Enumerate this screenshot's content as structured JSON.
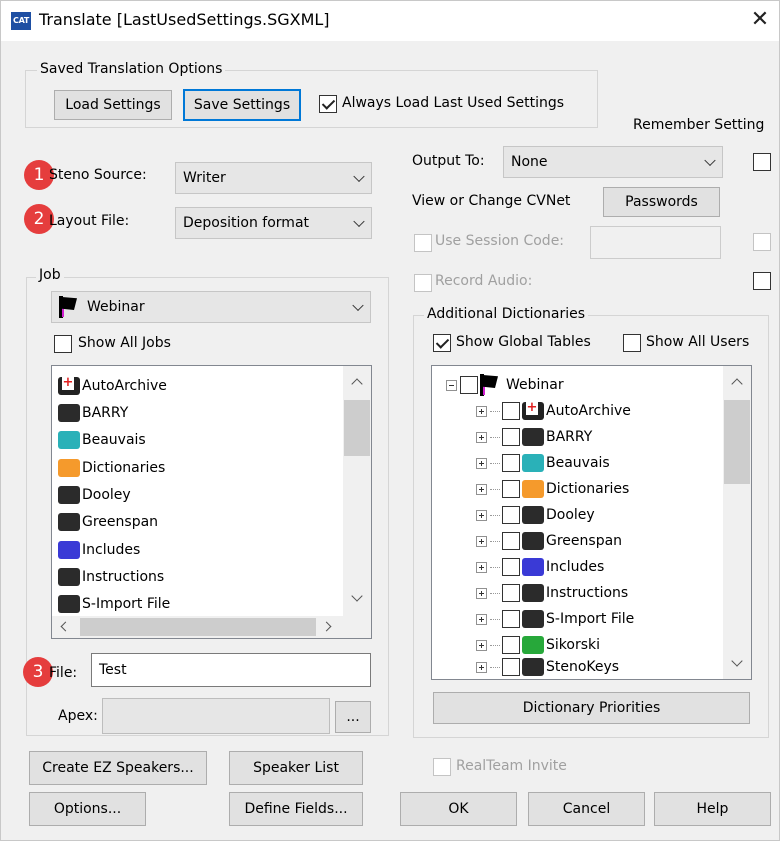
{
  "window": {
    "app_icon_text": "CAT",
    "title": "Translate [LastUsedSettings.SGXML]",
    "close_glyph": "✕"
  },
  "saved_options": {
    "group_label": "Saved Translation Options",
    "load_label": "Load Settings",
    "save_label": "Save Settings",
    "always_load_label": "Always Load Last Used Settings",
    "always_load_checked": true
  },
  "remember_setting_label": "Remember Setting",
  "badges": [
    "1",
    "2",
    "3"
  ],
  "steno_source": {
    "label": "Steno Source:",
    "value": "Writer"
  },
  "layout_file": {
    "label": "Layout File:",
    "value": "Deposition format"
  },
  "output_to": {
    "label": "Output To:",
    "value": "None"
  },
  "cvnet": {
    "label": "View or Change CVNet",
    "button": "Passwords"
  },
  "session_code": {
    "label": "Use Session Code:",
    "value": ""
  },
  "record_audio": {
    "label": "Record Audio:"
  },
  "job": {
    "group_label": "Job",
    "selected": "Webinar",
    "show_all_label": "Show All Jobs",
    "items": [
      {
        "label": "AutoArchive",
        "icon": "red-case-icon"
      },
      {
        "label": "BARRY",
        "icon": "black-case-icon"
      },
      {
        "label": "Beauvais",
        "icon": "teal-case-icon"
      },
      {
        "label": "Dictionaries",
        "icon": "orange-case-icon"
      },
      {
        "label": "Dooley",
        "icon": "black-case-icon"
      },
      {
        "label": "Greenspan",
        "icon": "black-case-icon"
      },
      {
        "label": "Includes",
        "icon": "blue-case-icon"
      },
      {
        "label": "Instructions",
        "icon": "black-case-icon"
      },
      {
        "label": "S-Import File",
        "icon": "black-case-icon"
      }
    ]
  },
  "file": {
    "label": "File:",
    "value": "Test"
  },
  "apex": {
    "label": "Apex:",
    "value": "",
    "browse": "..."
  },
  "additional_dictionaries": {
    "group_label": "Additional Dictionaries",
    "show_global_label": "Show Global Tables",
    "show_global_checked": true,
    "show_all_users_label": "Show All Users",
    "root": "Webinar",
    "items": [
      {
        "label": "AutoArchive",
        "icon": "red-case-icon"
      },
      {
        "label": "BARRY",
        "icon": "black-case-icon"
      },
      {
        "label": "Beauvais",
        "icon": "teal-case-icon"
      },
      {
        "label": "Dictionaries",
        "icon": "orange-case-icon"
      },
      {
        "label": "Dooley",
        "icon": "black-case-icon"
      },
      {
        "label": "Greenspan",
        "icon": "black-case-icon"
      },
      {
        "label": "Includes",
        "icon": "blue-case-icon"
      },
      {
        "label": "Instructions",
        "icon": "black-case-icon"
      },
      {
        "label": "S-Import File",
        "icon": "black-case-icon"
      },
      {
        "label": "Sikorski",
        "icon": "green-case-icon"
      },
      {
        "label": "StenoKeys",
        "icon": "black-case-icon"
      }
    ],
    "priorities_button": "Dictionary Priorities"
  },
  "buttons": {
    "create_ez": "Create EZ Speakers...",
    "speaker_list": "Speaker List",
    "realteam": "RealTeam Invite",
    "options": "Options...",
    "define_fields": "Define Fields...",
    "ok": "OK",
    "cancel": "Cancel",
    "help": "Help"
  }
}
